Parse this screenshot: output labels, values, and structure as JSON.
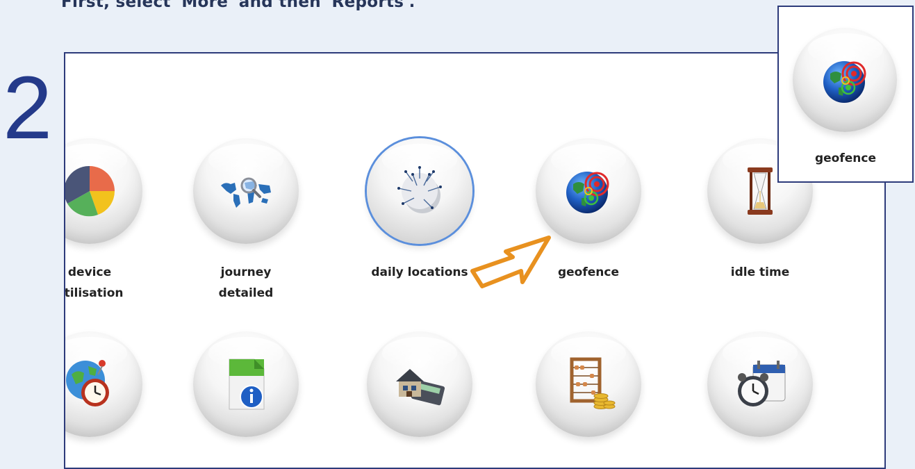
{
  "instruction": "First, select 'More' and then 'Reports'.",
  "step_number": "2",
  "reports": {
    "row1": [
      {
        "label": "device\nutilisation",
        "icon": "pie-chart-icon"
      },
      {
        "label": "journey\ndetailed",
        "icon": "world-map-magnifier-icon"
      },
      {
        "label": "daily locations",
        "icon": "globe-pins-icon",
        "selected": true
      },
      {
        "label": "geofence",
        "icon": "globe-target-icon"
      },
      {
        "label": "idle time",
        "icon": "hourglass-icon"
      }
    ],
    "row2": [
      {
        "label": "",
        "icon": "globe-clock-icon"
      },
      {
        "label": "",
        "icon": "document-info-icon"
      },
      {
        "label": "",
        "icon": "house-calculator-icon"
      },
      {
        "label": "",
        "icon": "abacus-coins-icon"
      },
      {
        "label": "",
        "icon": "alarm-clock-calendar-icon"
      }
    ]
  },
  "zoom": {
    "label": "geofence",
    "icon": "globe-target-icon"
  },
  "colors": {
    "frame": "#2c3a7a",
    "step": "#243a8a",
    "arrow": "#e8911f",
    "selected_ring": "#5b8fdc"
  }
}
